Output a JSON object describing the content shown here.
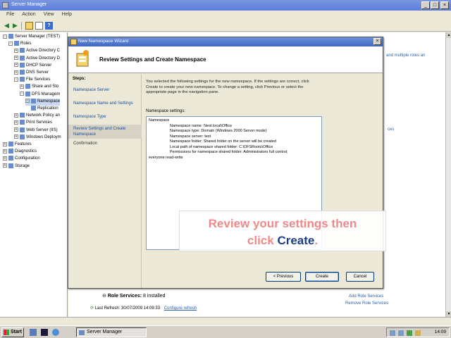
{
  "main_window": {
    "title": "Server Manager",
    "menu": [
      "File",
      "Action",
      "View",
      "Help"
    ],
    "tree": [
      {
        "label": "Server Manager (TEST)",
        "level": 0,
        "exp": "-"
      },
      {
        "label": "Roles",
        "level": 1,
        "exp": "-"
      },
      {
        "label": "Active Directory C",
        "level": 2,
        "exp": "+"
      },
      {
        "label": "Active Directory D",
        "level": 2,
        "exp": "+"
      },
      {
        "label": "DHCP Server",
        "level": 2,
        "exp": "+"
      },
      {
        "label": "DNS Server",
        "level": 2,
        "exp": "+"
      },
      {
        "label": "File Services",
        "level": 2,
        "exp": "-"
      },
      {
        "label": "Share and Sto",
        "level": 3,
        "exp": "+"
      },
      {
        "label": "DFS Managem",
        "level": 3,
        "exp": "-"
      },
      {
        "label": "Namespace",
        "level": 4,
        "exp": "-"
      },
      {
        "label": "Replication",
        "level": 4,
        "exp": ""
      },
      {
        "label": "Network Policy an",
        "level": 2,
        "exp": "+"
      },
      {
        "label": "Print Services",
        "level": 2,
        "exp": "+"
      },
      {
        "label": "Web Server (IIS)",
        "level": 2,
        "exp": "+"
      },
      {
        "label": "Windows Deploym",
        "level": 2,
        "exp": "+"
      },
      {
        "label": "Features",
        "level": 0,
        "exp": "+"
      },
      {
        "label": "Diagnostics",
        "level": 0,
        "exp": "+"
      },
      {
        "label": "Configuration",
        "level": 0,
        "exp": "+"
      },
      {
        "label": "Storage",
        "level": 0,
        "exp": "+"
      }
    ],
    "right_text_1": "and multiple roles an",
    "right_text_2": "ces",
    "role_services_label": "Role Services:",
    "role_services_value": "8 installed",
    "add_role_services": "Add Role Services",
    "remove_role_services": "Remove Role Services",
    "last_refresh": "Last Refresh: 30/07/2009 14:09:33",
    "configure_refresh": "Configure refresh"
  },
  "wizard": {
    "title": "New Namespace Wizard",
    "header_title": "Review Settings and Create Namespace",
    "steps_header": "Steps:",
    "steps": [
      {
        "label": "Namespace Server",
        "state": "link"
      },
      {
        "label": "Namespace Name and Settings",
        "state": "link"
      },
      {
        "label": "Namespace Type",
        "state": "link"
      },
      {
        "label": "Review Settings and Create Namespace",
        "state": "current"
      },
      {
        "label": "Confirmation",
        "state": "plain"
      }
    ],
    "description": "You selected the following settings for the new namespace. If the settings are correct, click Create to create your new namespace. To change a setting, click Previous or select the appropriate page in the navigation pane.",
    "settings_label": "Namespace settings:",
    "settings": {
      "heading": "Namespace",
      "lines": [
        "Namespace name: \\\\test.local\\Office",
        "Namespace type: Domain (Windows 2000 Server mode)",
        "Namespace server: test",
        "Namespace folder: Shared folder on the server will be created",
        "Local path of namespace shared folder: C:\\DFSRoots\\Office",
        "Permissions for namespace shared folder: Administrators full control;"
      ],
      "trailer": "everyone read-write"
    },
    "buttons": {
      "previous": "< Previous",
      "create": "Create",
      "cancel": "Cancel"
    }
  },
  "callout": {
    "line1": "Review your settings then",
    "line2_a": "click ",
    "line2_b": "Create",
    "line2_c": "."
  },
  "taskbar": {
    "start": "Start",
    "task": "Server Manager",
    "clock": "14:09"
  }
}
